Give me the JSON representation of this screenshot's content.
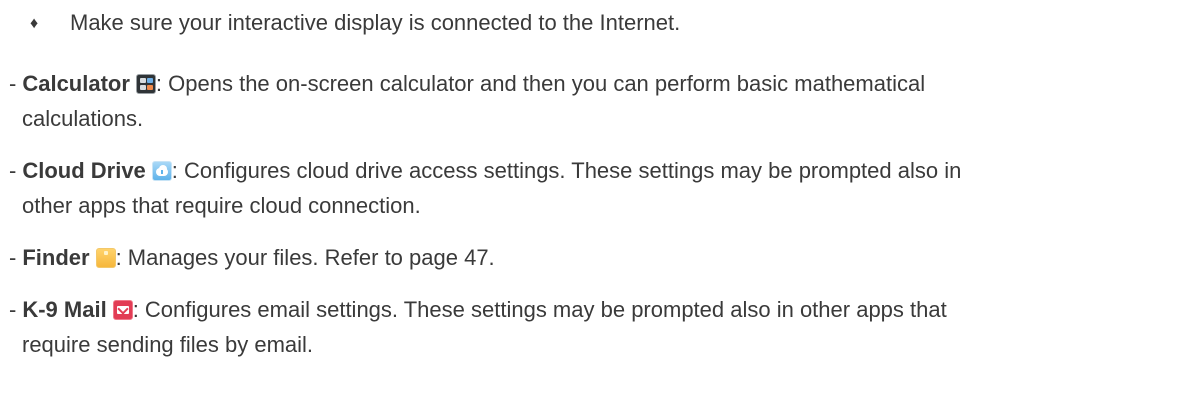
{
  "bullet": {
    "glyph": "♦",
    "text": "Make sure your interactive display is connected to the Internet."
  },
  "entries": [
    {
      "dash": "-",
      "term": "Calculator",
      "icon": "calculator-icon",
      "line1": ": Opens the on-screen calculator and then you can perform basic mathematical",
      "line2": "calculations."
    },
    {
      "dash": "-",
      "term": "Cloud Drive",
      "icon": "cloud-drive-icon",
      "line1": ": Configures cloud drive access settings. These settings may be prompted also in",
      "line2": "other apps that require cloud connection."
    },
    {
      "dash": "-",
      "term": "Finder",
      "icon": "finder-icon",
      "line1": ": Manages your files. Refer to page 47."
    },
    {
      "dash": "-",
      "term": "K-9 Mail",
      "icon": "mail-icon",
      "line1": ": Configures email settings. These settings may be prompted also in other apps that",
      "line2": "require sending files by email."
    }
  ],
  "colors": {
    "text": "#3a3a3a",
    "background": "#ffffff"
  }
}
